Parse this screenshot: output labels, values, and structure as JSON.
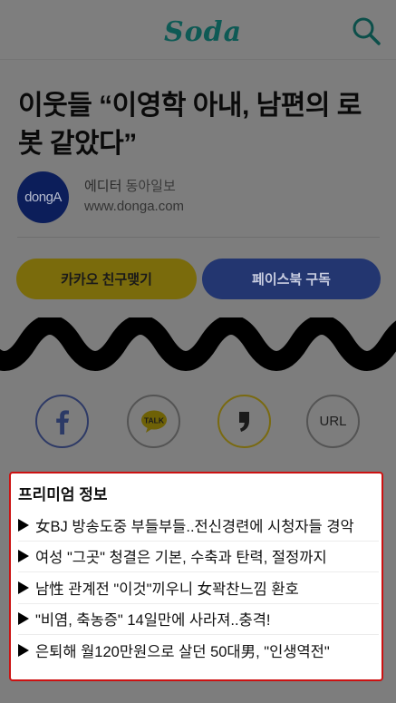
{
  "header": {
    "logo_text": "Soda",
    "search_icon": "search-icon"
  },
  "article": {
    "title": "이웃들 “이영학 아내, 남편의 로봇 같았다”",
    "avatar_text": "dongA",
    "editor_label": "에디터",
    "publisher": "동아일보",
    "url": "www.donga.com"
  },
  "buttons": {
    "kakao_label": "카카오 친구맺기",
    "facebook_label": "페이스북 구독"
  },
  "share": {
    "facebook_icon": "facebook-icon",
    "kakao_icon": "kakaotalk-icon",
    "kakao_text": "TALK",
    "story_icon": "kakaostory-icon",
    "url_label": "URL"
  },
  "premium": {
    "title": "프리미엄 정보",
    "items": [
      "女BJ 방송도중 부들부들..전신경련에 시청자들 경악",
      "여성 \"그곳\" 청결은 기본, 수축과 탄력, 절정까지",
      "남性 관계전 \"이것\"끼우니 女꽉찬느낌 환호",
      "\"비염, 축농증\" 14일만에 사라져..충격!",
      "은퇴해 월120만원으로 살던 50대男, \"인생역전\""
    ]
  },
  "colors": {
    "overlay": "#7d7d7d",
    "kakao_yellow": "#7a6b0c",
    "facebook_blue": "#233670",
    "premium_border": "#cc1111",
    "logo": "#0e5a55"
  }
}
